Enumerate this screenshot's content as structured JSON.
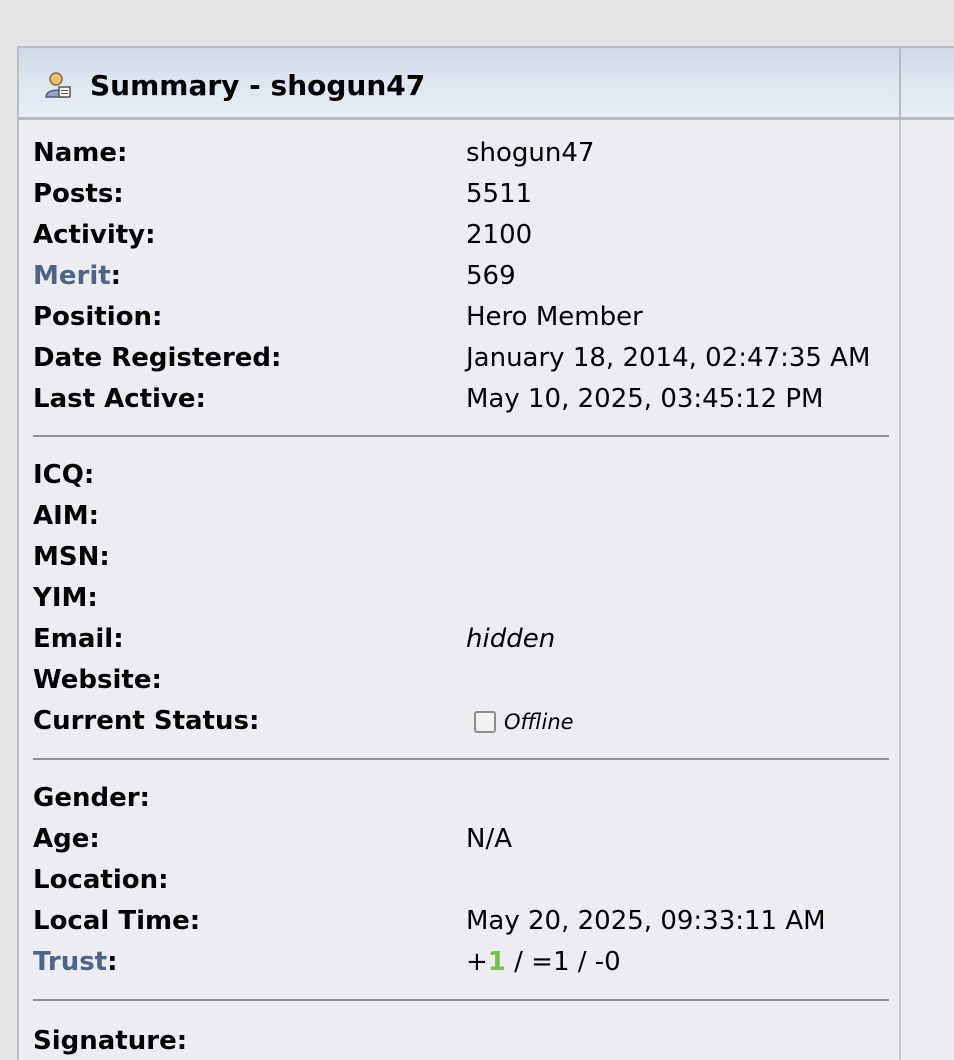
{
  "title": "Summary - shogun47",
  "summary": {
    "name": {
      "label": "Name:",
      "value": "shogun47"
    },
    "posts": {
      "label": "Posts:",
      "value": "5511"
    },
    "activity": {
      "label": "Activity:",
      "value": "2100"
    },
    "merit": {
      "label": "Merit",
      "colon": ":",
      "value": "569"
    },
    "position": {
      "label": "Position:",
      "value": "Hero Member"
    },
    "date_registered": {
      "label": "Date Registered:",
      "value": "January 18, 2014, 02:47:35 AM"
    },
    "last_active": {
      "label": "Last Active:",
      "value": "May 10, 2025, 03:45:12 PM"
    }
  },
  "contact": {
    "icq": {
      "label": "ICQ:",
      "value": ""
    },
    "aim": {
      "label": "AIM:",
      "value": ""
    },
    "msn": {
      "label": "MSN:",
      "value": ""
    },
    "yim": {
      "label": "YIM:",
      "value": ""
    },
    "email": {
      "label": "Email:",
      "value": "hidden"
    },
    "website": {
      "label": "Website:",
      "value": ""
    },
    "current_status": {
      "label": "Current Status:",
      "value": "Offline"
    }
  },
  "personal": {
    "gender": {
      "label": "Gender:",
      "value": ""
    },
    "age": {
      "label": "Age:",
      "value": "N/A"
    },
    "location": {
      "label": "Location:",
      "value": ""
    },
    "local_time": {
      "label": "Local Time:",
      "value": "May 20, 2025, 09:33:11 AM"
    },
    "trust": {
      "label": "Trust",
      "colon": ":",
      "plus_sign": "+",
      "positive": "1",
      "rest": " / =1 / -0"
    }
  },
  "signature": {
    "label": "Signature:"
  },
  "colors": {
    "link": "#4e6587",
    "trust_positive": "#7bbf4c",
    "panel_bg": "#ecedf3",
    "page_bg": "#e5e5e8"
  },
  "icons": {
    "title": "user-profile-icon",
    "status": "offline-status-icon"
  }
}
